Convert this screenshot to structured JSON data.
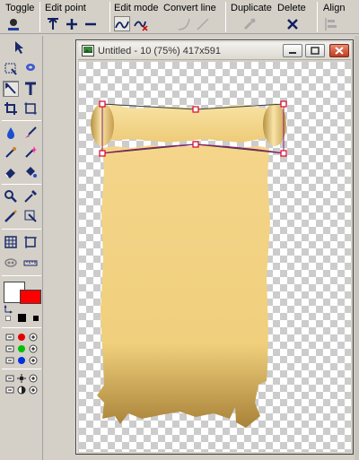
{
  "toolbar": {
    "toggle_label": "Toggle",
    "edit_point_label": "Edit point",
    "edit_mode_label": "Edit mode",
    "convert_line_label": "Convert line",
    "duplicate_label": "Duplicate",
    "delete_label": "Delete",
    "align_label": "Align"
  },
  "document": {
    "title": "Untitled - 10 (75%) 417x591"
  },
  "colors": {
    "foreground": "#ffffff",
    "background": "#ff0000",
    "scroll_fill": "#f2d27e",
    "selection_line": "#8b1e6e",
    "handle": "#d9002a"
  },
  "palette_icons": [
    "pointer-icon",
    "marquee-icon",
    "lasso-icon",
    "path-edit-icon",
    "text-icon",
    "crop-icon",
    "transform-icon",
    "fill-bucket-icon",
    "brush-icon",
    "airbrush-icon",
    "sparkle-brush-icon",
    "eraser-icon",
    "paint-bucket-icon",
    "zoom-icon",
    "eyedropper-icon",
    "pencil-icon",
    "clone-icon",
    "grid-icon",
    "canvas-icon",
    "mask-icon",
    "ruler-icon"
  ]
}
